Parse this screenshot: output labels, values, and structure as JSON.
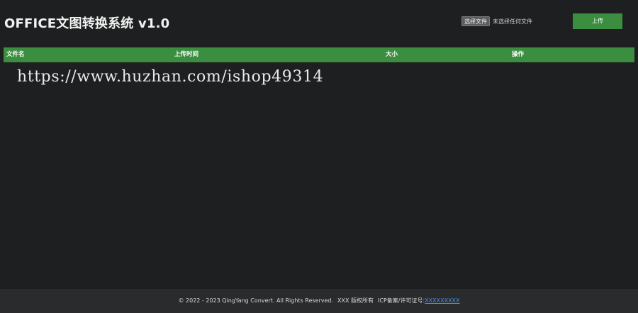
{
  "header": {
    "title": "OFFICE文图转换系统 v1.0"
  },
  "file_picker": {
    "choose_label": "选择文件",
    "status_text": "未选择任何文件"
  },
  "upload": {
    "label": "上传"
  },
  "table": {
    "columns": [
      "文件名",
      "上传时间",
      "大小",
      "操作"
    ],
    "accent_color": "#3b8e3f"
  },
  "watermark": {
    "text": "https://www.huzhan.com/ishop49314"
  },
  "footer": {
    "copyright": "© 2022 - 2023 QingYang Convert. All Rights Reserved.",
    "rights": "XXX 版权所有",
    "icp_label": "ICP备案/许可证号:",
    "icp_number": "XXXXXXXXX",
    "link_color": "#4a90e2"
  }
}
